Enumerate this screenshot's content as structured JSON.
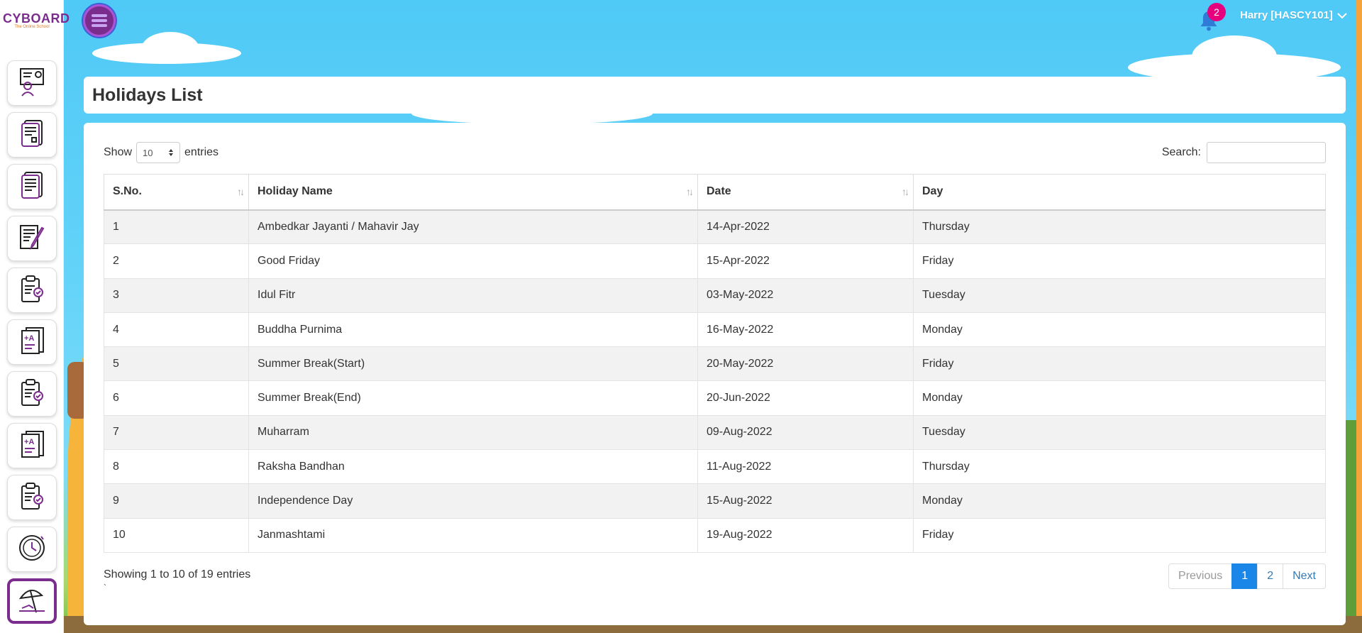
{
  "brand": {
    "logo_main": "CYBOARD",
    "logo_sub": "The Online School"
  },
  "header": {
    "notification_count": "2",
    "user_name": "Harry [HASCY101]"
  },
  "sidebar": {
    "items": [
      {
        "icon": "teacher-board-icon"
      },
      {
        "icon": "newspaper-icon"
      },
      {
        "icon": "report-sheet-icon"
      },
      {
        "icon": "edit-document-icon"
      },
      {
        "icon": "clipboard-check-icon"
      },
      {
        "icon": "grade-document-icon"
      },
      {
        "icon": "clipboard-check-icon"
      },
      {
        "icon": "grade-document-icon"
      },
      {
        "icon": "clipboard-check-icon"
      },
      {
        "icon": "clock-icon"
      },
      {
        "icon": "beach-umbrella-icon"
      }
    ],
    "active_index": 10
  },
  "page": {
    "title": "Holidays List"
  },
  "table_controls": {
    "show_label": "Show",
    "entries_label": "entries",
    "page_size": "10",
    "search_label": "Search:",
    "search_value": ""
  },
  "table": {
    "columns": [
      "S.No.",
      "Holiday Name",
      "Date",
      "Day"
    ],
    "rows": [
      [
        "1",
        "Ambedkar Jayanti / Mahavir Jay",
        "14-Apr-2022",
        "Thursday"
      ],
      [
        "2",
        "Good Friday",
        "15-Apr-2022",
        "Friday"
      ],
      [
        "3",
        "Idul Fitr",
        "03-May-2022",
        "Tuesday"
      ],
      [
        "4",
        "Buddha Purnima",
        "16-May-2022",
        "Monday"
      ],
      [
        "5",
        "Summer Break(Start)",
        "20-May-2022",
        "Friday"
      ],
      [
        "6",
        "Summer Break(End)",
        "20-Jun-2022",
        "Monday"
      ],
      [
        "7",
        "Muharram",
        "09-Aug-2022",
        "Tuesday"
      ],
      [
        "8",
        "Raksha Bandhan",
        "11-Aug-2022",
        "Thursday"
      ],
      [
        "9",
        "Independence Day",
        "15-Aug-2022",
        "Monday"
      ],
      [
        "10",
        "Janmashtami",
        "19-Aug-2022",
        "Friday"
      ]
    ]
  },
  "footer": {
    "info": "Showing 1 to 10 of 19 entries",
    "stray_mark": "`"
  },
  "pagination": {
    "previous": "Previous",
    "pages": [
      "1",
      "2"
    ],
    "current": "1",
    "next": "Next"
  },
  "colors": {
    "brand_purple": "#7b2d8e",
    "sky": "#4fc9f6",
    "accent_blue": "#1a86e8",
    "badge_pink": "#e6007e"
  }
}
